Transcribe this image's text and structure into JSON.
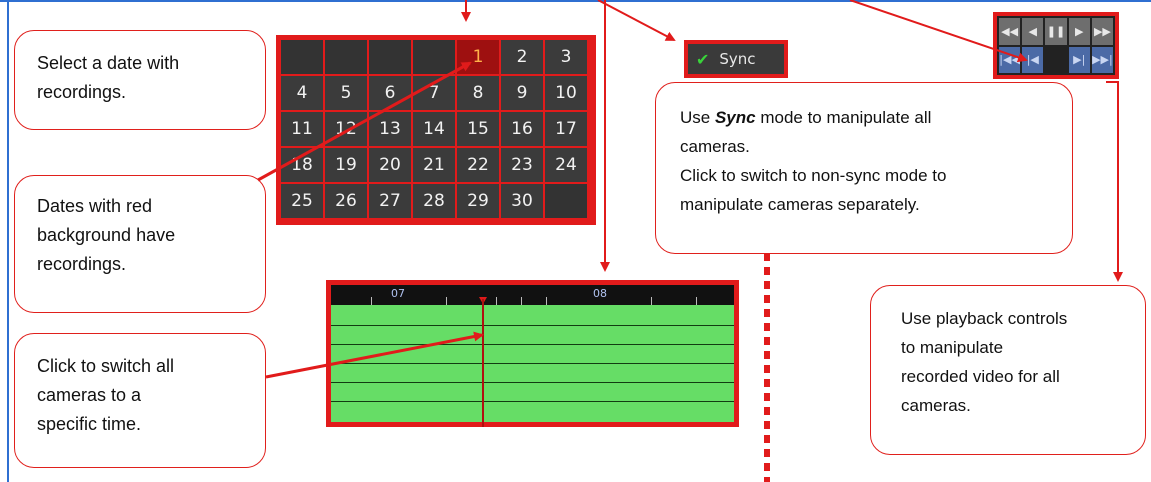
{
  "calendar": {
    "cells": [
      "",
      "",
      "",
      "",
      "1",
      "2",
      "3",
      "4",
      "5",
      "6",
      "7",
      "8",
      "9",
      "10",
      "11",
      "12",
      "13",
      "14",
      "15",
      "16",
      "17",
      "18",
      "19",
      "20",
      "21",
      "22",
      "23",
      "24",
      "25",
      "26",
      "27",
      "28",
      "29",
      "30",
      ""
    ],
    "recording_dates": [
      "1"
    ]
  },
  "sync_button": {
    "label": "Sync"
  },
  "timeline": {
    "hour_labels": [
      "07",
      "08"
    ]
  },
  "colors": {
    "annotation_red": "#e11b1b",
    "frame_blue": "#2f6fd1",
    "timeline_green": "#66dd66",
    "recording_cell": "#9e1010"
  },
  "callouts": {
    "select_date": [
      "Select a date with",
      "recordings."
    ],
    "red_dates": [
      "Dates with red",
      "background have",
      "recordings."
    ],
    "click_time": [
      "Click to switch all",
      "cameras to a",
      "specific time."
    ],
    "sync_line1_bold": "Sync",
    "sync_line1_pre": "Use ",
    "sync_line1_post": " mode to manipulate all",
    "sync_rest": [
      "cameras.",
      "Click to switch to non-sync mode to",
      "manipulate cameras separately."
    ],
    "playback": [
      "Use playback controls",
      "to manipulate",
      "recorded video for all",
      "cameras."
    ]
  },
  "icons": {
    "sync_check": "check-icon",
    "playback_top": [
      "fast-rewind-icon",
      "step-back-icon",
      "pause-icon",
      "play-icon",
      "fast-forward-icon"
    ],
    "playback_bottom": [
      "skip-first-icon",
      "prev-frame-icon",
      "",
      "next-frame-icon",
      "skip-last-icon"
    ]
  }
}
